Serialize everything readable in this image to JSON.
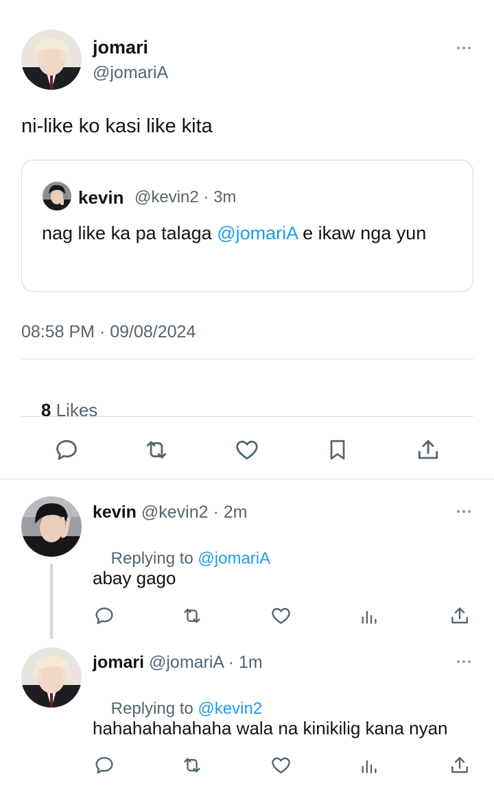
{
  "main_post": {
    "author_name": "jomari",
    "author_handle": "@jomariA",
    "text": "ni-like ko kasi like kita",
    "quote": {
      "author_name": "kevin",
      "author_handle": "@kevin2",
      "time": "3m",
      "text_before": "nag like ka pa talaga ",
      "mention": "@jomariA",
      "text_after": " e ikaw nga yun"
    },
    "timestamp": "08:58 PM · 09/08/2024",
    "likes_count": "8",
    "likes_label": "Likes",
    "actions": [
      "reply-icon",
      "retweet-icon",
      "like-icon",
      "bookmark-icon",
      "share-icon"
    ]
  },
  "replies": [
    {
      "author_name": "kevin",
      "author_handle": "@kevin2",
      "time": "2m",
      "replying_label": "Replying to",
      "replying_to": "@jomariA",
      "text": "abay gago",
      "actions": [
        "reply-icon",
        "retweet-icon",
        "like-icon",
        "views-icon",
        "share-icon"
      ]
    },
    {
      "author_name": "jomari",
      "author_handle": "@jomariA",
      "time": "1m",
      "replying_label": "Replying to",
      "replying_to": "@kevin2",
      "text": "hahahahahahaha wala na kinikilig kana nyan",
      "actions": [
        "reply-icon",
        "retweet-icon",
        "like-icon",
        "views-icon",
        "share-icon"
      ]
    }
  ],
  "separator": " · ",
  "colors": {
    "text": "#0f1419",
    "muted": "#536471",
    "link": "#1d9bf0",
    "divider": "#d9dee2",
    "icon": "#536471"
  }
}
